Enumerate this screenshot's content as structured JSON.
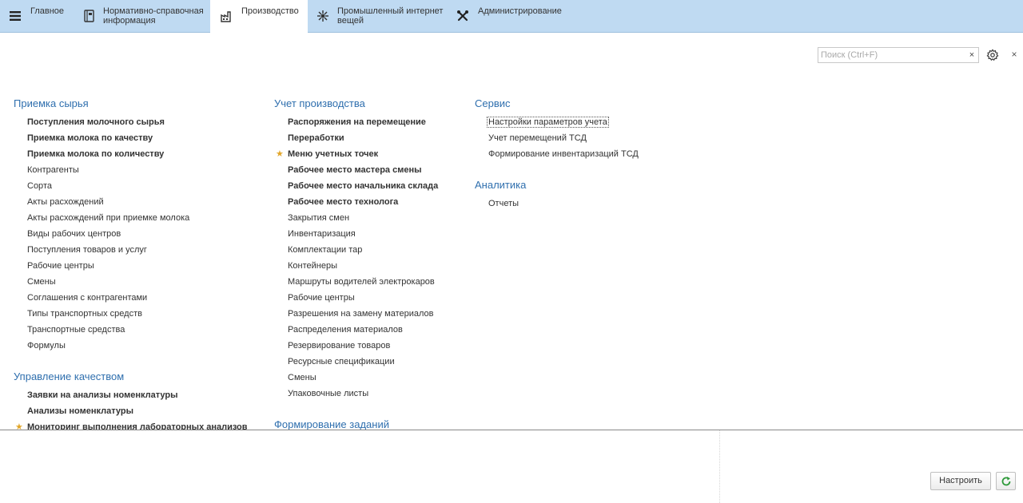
{
  "sections": [
    {
      "label": "Главное",
      "icon": "hamburger-menu-icon"
    },
    {
      "label": "Нормативно-справочная\nинформация",
      "icon": "reference-book-icon"
    },
    {
      "label": "Производство",
      "icon": "factory-icon"
    },
    {
      "label": "Промышленный интернет\nвещей",
      "icon": "iot-network-icon"
    },
    {
      "label": "Администрирование",
      "icon": "tools-icon"
    }
  ],
  "active_section": "Производство",
  "search": {
    "placeholder": "Поиск (Ctrl+F)",
    "value": "",
    "clear_label": "×"
  },
  "close_label": "×",
  "columns": [
    {
      "groups": [
        {
          "title": "Приемка сырья",
          "items": [
            {
              "label": "Поступления молочного сырья",
              "bold": true
            },
            {
              "label": "Приемка молока по качеству",
              "bold": true
            },
            {
              "label": "Приемка молока по количеству",
              "bold": true
            },
            {
              "label": "Контрагенты"
            },
            {
              "label": "Сорта"
            },
            {
              "label": "Акты расхождений"
            },
            {
              "label": "Акты расхождений при приемке молока"
            },
            {
              "label": "Виды рабочих центров"
            },
            {
              "label": "Поступления товаров и услуг"
            },
            {
              "label": "Рабочие центры"
            },
            {
              "label": "Смены"
            },
            {
              "label": "Соглашения с контрагентами"
            },
            {
              "label": "Типы транспортных средств"
            },
            {
              "label": "Транспортные средства"
            },
            {
              "label": "Формулы"
            }
          ]
        },
        {
          "title": "Управление качеством",
          "items": [
            {
              "label": "Заявки на анализы номенклатуры",
              "bold": true
            },
            {
              "label": "Анализы номенклатуры",
              "bold": true
            },
            {
              "label": "Мониторинг выполнения лабораторных анализов",
              "bold": true,
              "favorite": true
            }
          ]
        }
      ]
    },
    {
      "groups": [
        {
          "title": "Учет производства",
          "items": [
            {
              "label": "Распоряжения на перемещение",
              "bold": true
            },
            {
              "label": "Переработки",
              "bold": true
            },
            {
              "label": "Меню учетных точек",
              "bold": true,
              "favorite": true
            },
            {
              "label": "Рабочее место мастера смены",
              "bold": true
            },
            {
              "label": "Рабочее место начальника склада",
              "bold": true
            },
            {
              "label": "Рабочее место технолога",
              "bold": true
            },
            {
              "label": "Закрытия смен"
            },
            {
              "label": "Инвентаризация"
            },
            {
              "label": "Комплектации тар"
            },
            {
              "label": "Контейнеры"
            },
            {
              "label": "Маршруты водителей электрокаров"
            },
            {
              "label": "Рабочие центры"
            },
            {
              "label": "Разрешения на замену материалов"
            },
            {
              "label": "Распределения материалов"
            },
            {
              "label": "Резервирование товаров"
            },
            {
              "label": "Ресурсные спецификации"
            },
            {
              "label": "Смены"
            },
            {
              "label": "Упаковочные листы"
            }
          ]
        },
        {
          "title": "Формирование заданий",
          "items": []
        }
      ]
    },
    {
      "groups": [
        {
          "title": "Сервис",
          "items": [
            {
              "label": "Настройки параметров учета",
              "focused": true
            },
            {
              "label": "Учет перемещений ТСД"
            },
            {
              "label": "Формирование инвентаризаций ТСД"
            }
          ]
        },
        {
          "title": "Аналитика",
          "items": [
            {
              "label": "Отчеты"
            }
          ]
        }
      ]
    }
  ],
  "footer": {
    "configure_label": "Настроить"
  },
  "colors": {
    "topbar": "#bfdaf2",
    "group_title": "#2f6fae",
    "favorite_star": "#e2a62a",
    "refresh_icon": "#2e9a3a"
  }
}
